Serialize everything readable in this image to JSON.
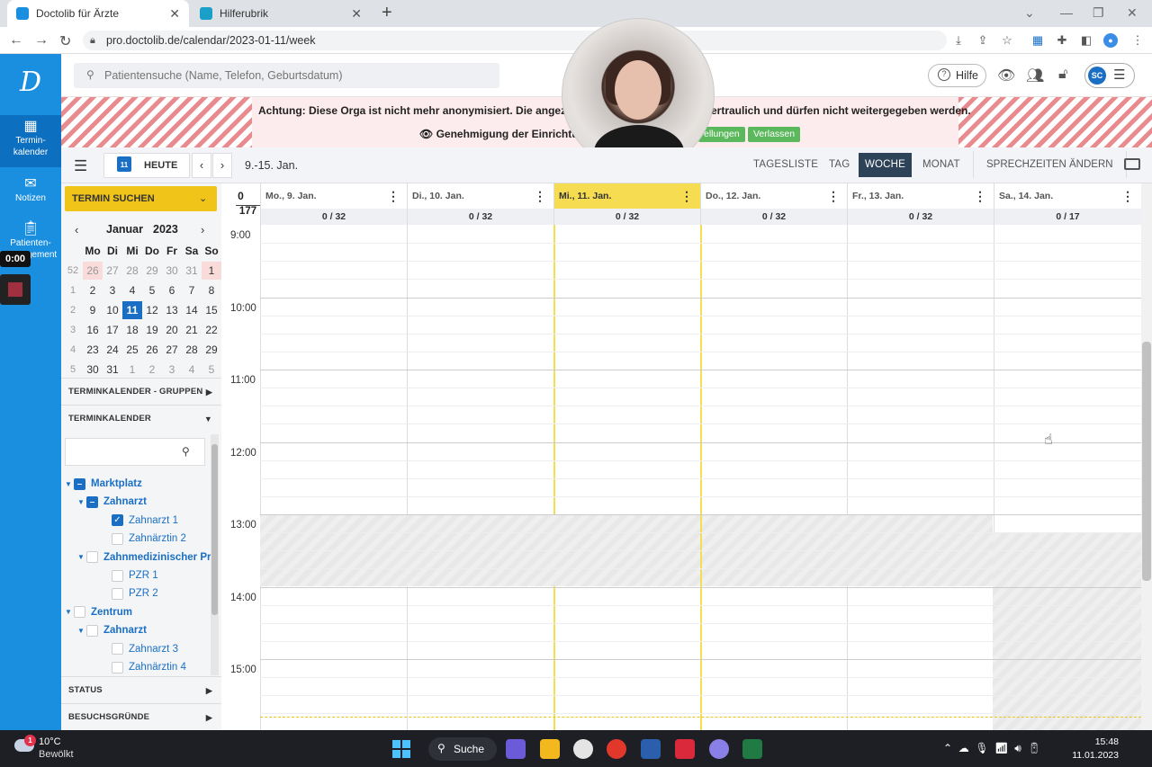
{
  "browser": {
    "tabs": [
      {
        "label": "Doctolib für Ärzte",
        "active": true
      },
      {
        "label": "Hilferubrik",
        "active": false
      }
    ],
    "url": "pro.doctolib.de/calendar/2023-01-11/week"
  },
  "sidebar": {
    "items": [
      {
        "label": "Termin-\nkalender",
        "icon": "calendar-icon",
        "active": true
      },
      {
        "label": "Notizen",
        "icon": "envelope-icon"
      },
      {
        "label": "Patienten-\nmanagement",
        "icon": "clipboard-icon"
      }
    ],
    "recording_time": "0:00"
  },
  "header": {
    "search_placeholder": "Patientensuche (Name, Telefon, Geburtsdatum)",
    "help_label": "Hilfe",
    "user_initials": "SC"
  },
  "banner": {
    "line1_left": "Achtung: Diese Orga ist nicht mehr anonymisiert. Die angezeigt",
    "line1_right": "ertraulich und dürfen nicht weitergegeben werden.",
    "line2": "Genehmigung der Einrichtun",
    "btn_settings": "ellungen",
    "btn_leave": "Verlassen"
  },
  "toolbar": {
    "today_badge": "11",
    "today_label": "HEUTE",
    "range": "9.-15. Jan.",
    "views": [
      "TAGESLISTE",
      "TAG",
      "WOCHE",
      "MONAT"
    ],
    "active_view": "WOCHE",
    "sprechzeiten": "SPRECHZEITEN ÄNDERN"
  },
  "left_panel": {
    "termin_suchen": "TERMIN SUCHEN",
    "month": "Januar",
    "year": "2023",
    "weekday_headers": [
      "Mo",
      "Di",
      "Mi",
      "Do",
      "Fr",
      "Sa",
      "So"
    ],
    "weeks": [
      {
        "wk": "52",
        "days": [
          "26",
          "27",
          "28",
          "29",
          "30",
          "31",
          "1"
        ]
      },
      {
        "wk": "1",
        "days": [
          "2",
          "3",
          "4",
          "5",
          "6",
          "7",
          "8"
        ]
      },
      {
        "wk": "2",
        "days": [
          "9",
          "10",
          "11",
          "12",
          "13",
          "14",
          "15"
        ]
      },
      {
        "wk": "3",
        "days": [
          "16",
          "17",
          "18",
          "19",
          "20",
          "21",
          "22"
        ]
      },
      {
        "wk": "4",
        "days": [
          "23",
          "24",
          "25",
          "26",
          "27",
          "28",
          "29"
        ]
      },
      {
        "wk": "5",
        "days": [
          "30",
          "31",
          "1",
          "2",
          "3",
          "4",
          "5"
        ]
      }
    ],
    "selected_day": "11",
    "sections": {
      "groups": "TERMINKALENDER - GRUPPEN",
      "calendars": "TERMINKALENDER",
      "status": "STATUS",
      "reasons": "BESUCHSGRÜNDE"
    },
    "tree": [
      {
        "label": "Marktplatz",
        "level": 0,
        "bold": true,
        "expander": true,
        "check": "part"
      },
      {
        "label": "Zahnarzt",
        "level": 1,
        "bold": true,
        "expander": true,
        "check": "part"
      },
      {
        "label": "Zahnarzt 1",
        "level": 2,
        "bold": false,
        "expander": false,
        "check": "on"
      },
      {
        "label": "Zahnärztin 2",
        "level": 2,
        "bold": false,
        "expander": false,
        "check": "off"
      },
      {
        "label": "Zahnmedizinischer Pro",
        "level": 1,
        "bold": true,
        "expander": true,
        "check": "off"
      },
      {
        "label": "PZR 1",
        "level": 2,
        "bold": false,
        "expander": false,
        "check": "off"
      },
      {
        "label": "PZR 2",
        "level": 2,
        "bold": false,
        "expander": false,
        "check": "off"
      },
      {
        "label": "Zentrum",
        "level": 0,
        "bold": true,
        "expander": true,
        "check": "off"
      },
      {
        "label": "Zahnarzt",
        "level": 1,
        "bold": true,
        "expander": true,
        "check": "off"
      },
      {
        "label": "Zahnarzt 3",
        "level": 2,
        "bold": false,
        "expander": false,
        "check": "off"
      },
      {
        "label": "Zahnärztin 4",
        "level": 2,
        "bold": false,
        "expander": false,
        "check": "off"
      }
    ]
  },
  "calendar": {
    "corner_top": "0",
    "corner_bottom": "177",
    "days": [
      {
        "label": "Mo., 9. Jan.",
        "count": "0 / 32",
        "today": false
      },
      {
        "label": "Di., 10. Jan.",
        "count": "0 / 32",
        "today": false
      },
      {
        "label": "Mi., 11. Jan.",
        "count": "0 / 32",
        "today": true
      },
      {
        "label": "Do., 12. Jan.",
        "count": "0 / 32",
        "today": false
      },
      {
        "label": "Fr., 13. Jan.",
        "count": "0 / 32",
        "today": false
      },
      {
        "label": "Sa., 14. Jan.",
        "count": "0 / 17",
        "today": false
      }
    ],
    "hours": [
      "9:00",
      "10:00",
      "11:00",
      "12:00",
      "13:00",
      "14:00",
      "15:00"
    ]
  },
  "taskbar": {
    "weather_badge": "1",
    "temp": "10°C",
    "weather": "Bewölkt",
    "search": "Suche",
    "time": "15:48",
    "date": "11.01.2023"
  }
}
